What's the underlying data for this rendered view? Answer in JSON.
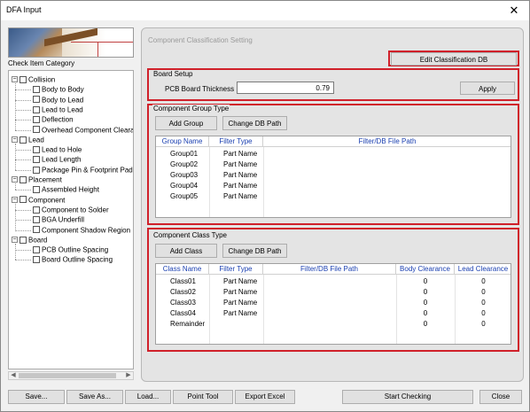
{
  "window": {
    "title": "DFA Input",
    "close_glyph": "✕"
  },
  "left": {
    "category_label": "Check Item Category",
    "tree": [
      {
        "label": "Collision",
        "level": 0,
        "expand": "−"
      },
      {
        "label": "Body to Body",
        "level": 1
      },
      {
        "label": "Body to Lead",
        "level": 1
      },
      {
        "label": "Lead to Lead",
        "level": 1
      },
      {
        "label": "Deflection",
        "level": 1
      },
      {
        "label": "Overhead Component Clearar",
        "level": 1
      },
      {
        "label": "Lead",
        "level": 0,
        "expand": "−"
      },
      {
        "label": "Lead to Hole",
        "level": 1
      },
      {
        "label": "Lead Length",
        "level": 1
      },
      {
        "label": "Package Pin & Footprint Pad",
        "level": 1
      },
      {
        "label": "Placement",
        "level": 0,
        "expand": "−"
      },
      {
        "label": "Assembled Height",
        "level": 1
      },
      {
        "label": "Component",
        "level": 0,
        "expand": "−"
      },
      {
        "label": "Component to Solder",
        "level": 1
      },
      {
        "label": "BGA Underfill",
        "level": 1
      },
      {
        "label": "Component Shadow Region",
        "level": 1
      },
      {
        "label": "Board",
        "level": 0,
        "expand": "−"
      },
      {
        "label": "PCB Outline Spacing",
        "level": 1
      },
      {
        "label": "Board Outline Spacing",
        "level": 1
      }
    ]
  },
  "panel": {
    "title": "Component Classification Setting",
    "edit_db_label": "Edit Classification DB",
    "board_setup": {
      "label": "Board Setup",
      "thickness_label": "PCB Board Thickness :",
      "thickness_value": "0.79",
      "apply_label": "Apply"
    },
    "group_type": {
      "label": "Component Group Type",
      "add_label": "Add Group",
      "change_path_label": "Change DB Path",
      "headers": [
        "Group Name",
        "Filter Type",
        "Filter/DB File Path"
      ],
      "rows": [
        [
          "Group01",
          "Part Name",
          ""
        ],
        [
          "Group02",
          "Part Name",
          ""
        ],
        [
          "Group03",
          "Part Name",
          ""
        ],
        [
          "Group04",
          "Part Name",
          ""
        ],
        [
          "Group05",
          "Part Name",
          ""
        ]
      ]
    },
    "class_type": {
      "label": "Component Class Type",
      "add_label": "Add Class",
      "change_path_label": "Change DB Path",
      "headers": [
        "Class Name",
        "Filter Type",
        "Filter/DB File Path",
        "Body Clearance",
        "Lead Clearance"
      ],
      "rows": [
        [
          "Class01",
          "Part Name",
          "",
          "0",
          "0"
        ],
        [
          "Class02",
          "Part Name",
          "",
          "0",
          "0"
        ],
        [
          "Class03",
          "Part Name",
          "",
          "0",
          "0"
        ],
        [
          "Class04",
          "Part Name",
          "",
          "0",
          "0"
        ],
        [
          "Remainder",
          "",
          "",
          "0",
          "0"
        ]
      ]
    }
  },
  "footer": {
    "save": "Save...",
    "save_as": "Save As...",
    "load": "Load...",
    "point_tool": "Point Tool",
    "export_excel": "Export Excel",
    "start_checking": "Start Checking",
    "close": "Close"
  },
  "colors": {
    "highlight_border": "#d0202a",
    "header_text": "#1a3fb0"
  }
}
